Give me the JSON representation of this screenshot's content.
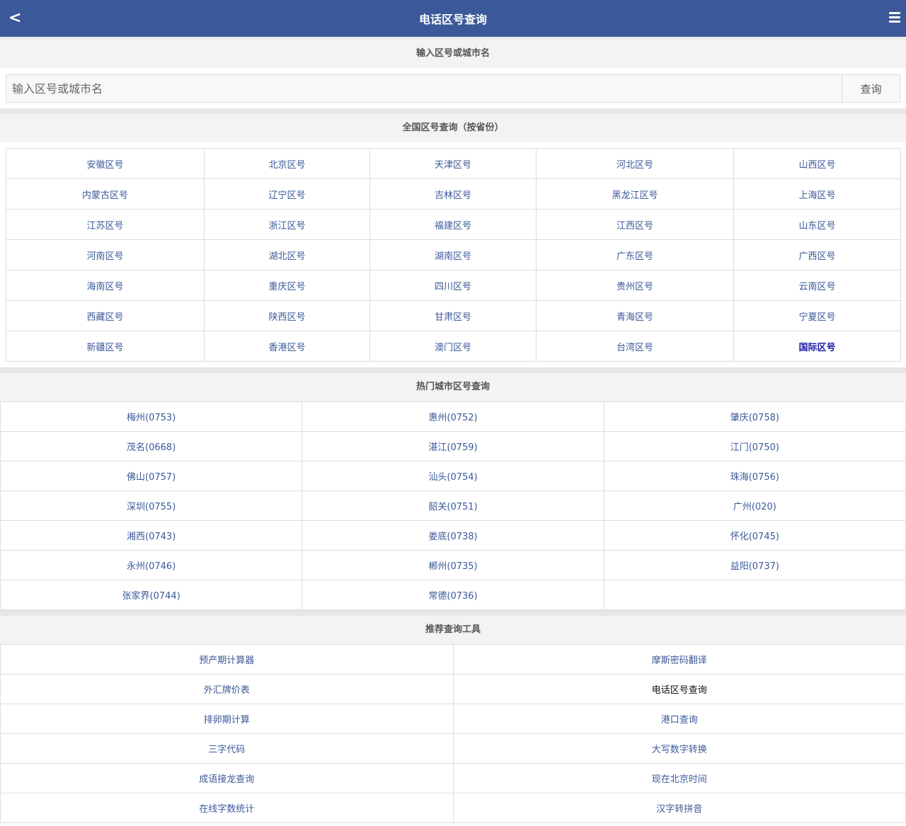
{
  "header": {
    "title": "电话区号查询",
    "back_label": "<",
    "menu_icon": "menu-icon"
  },
  "search": {
    "section_title": "输入区号或城市名",
    "placeholder": "输入区号或城市名",
    "value": "",
    "button_label": "查询"
  },
  "provinces": {
    "section_title": "全国区号查询（按省份）",
    "rows": [
      [
        "安徽区号",
        "北京区号",
        "天津区号",
        "河北区号",
        "山西区号"
      ],
      [
        "内蒙古区号",
        "辽宁区号",
        "吉林区号",
        "黑龙江区号",
        "上海区号"
      ],
      [
        "江苏区号",
        "浙江区号",
        "福建区号",
        "江西区号",
        "山东区号"
      ],
      [
        "河南区号",
        "湖北区号",
        "湖南区号",
        "广东区号",
        "广西区号"
      ],
      [
        "海南区号",
        "重庆区号",
        "四川区号",
        "贵州区号",
        "云南区号"
      ],
      [
        "西藏区号",
        "陕西区号",
        "甘肃区号",
        "青海区号",
        "宁夏区号"
      ],
      [
        "新疆区号",
        "香港区号",
        "澳门区号",
        "台湾区号",
        "国际区号"
      ]
    ]
  },
  "hot_cities": {
    "section_title": "热门城市区号查询",
    "rows": [
      [
        "梅州(0753)",
        "惠州(0752)",
        "肇庆(0758)"
      ],
      [
        "茂名(0668)",
        "湛江(0759)",
        "江门(0750)"
      ],
      [
        "佛山(0757)",
        "汕头(0754)",
        "珠海(0756)"
      ],
      [
        "深圳(0755)",
        "韶关(0751)",
        "广州(020)"
      ],
      [
        "湘西(0743)",
        "娄底(0738)",
        "怀化(0745)"
      ],
      [
        "永州(0746)",
        "郴州(0735)",
        "益阳(0737)"
      ],
      [
        "张家界(0744)",
        "常德(0736)",
        ""
      ]
    ]
  },
  "tools": {
    "section_title": "推荐查询工具",
    "rows": [
      [
        "预产期计算器",
        "摩斯密码翻译"
      ],
      [
        "外汇牌价表",
        "电话区号查询"
      ],
      [
        "排卵期计算",
        "港口查询"
      ],
      [
        "三字代码",
        "大写数字转换"
      ],
      [
        "成语接龙查询",
        "现在北京时间"
      ],
      [
        "在线字数统计",
        "汉字转拼音"
      ]
    ]
  },
  "colors": {
    "header_bg": "#3b5998",
    "link": "#3b5998",
    "active": "#111111",
    "international": "#1a1aa6"
  }
}
